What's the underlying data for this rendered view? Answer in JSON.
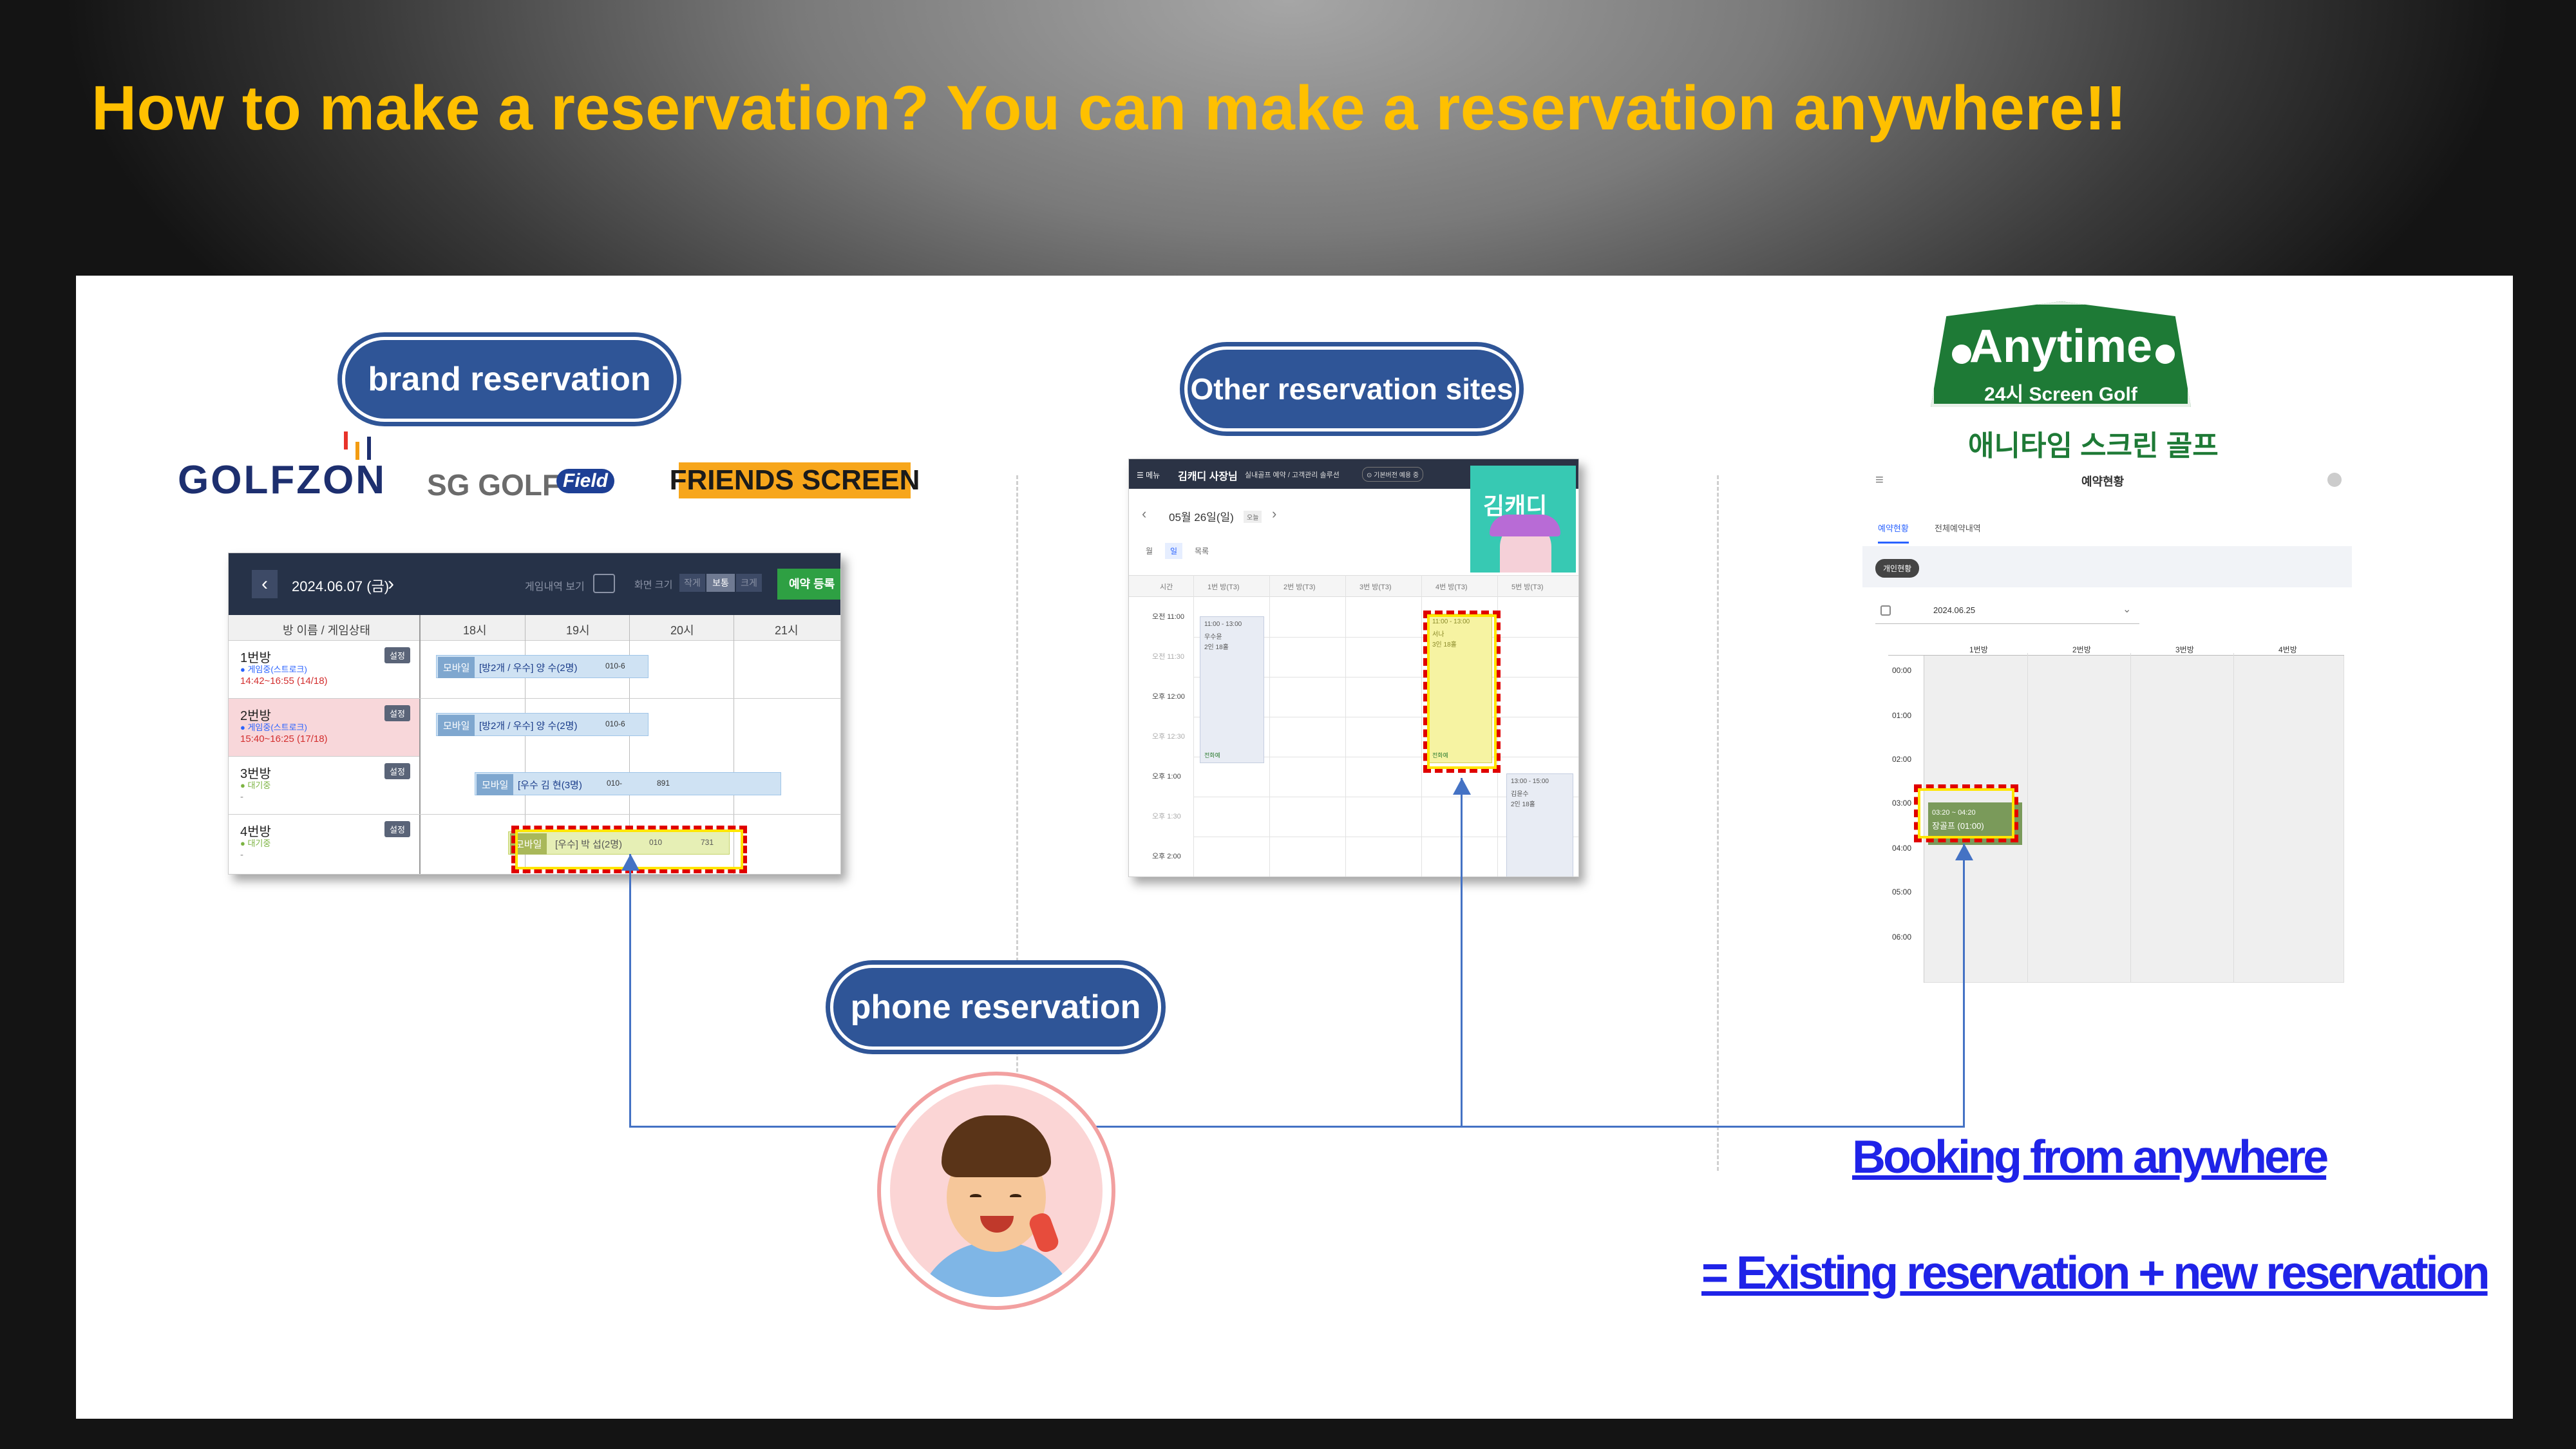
{
  "slide": {
    "title": "How to make a reservation? You can make a reservation anywhere!!"
  },
  "pills": {
    "brand": "brand reservation",
    "other": "Other reservation sites",
    "phone": "phone reservation"
  },
  "brands": {
    "golfzon": "GOLFZON",
    "sggolf": "SG GOLF",
    "sggolf_badge": "Field",
    "friends": "FRIENDS SCREEN"
  },
  "anytime": {
    "logo_main": "Anytime",
    "logo_sub": "24시 Screen Golf",
    "korean_name": "애니타임 스크린 골프"
  },
  "shot1": {
    "date": "2024.06.07 (금)",
    "toggle_label": "게임내역 보기",
    "size_label": "화면 크기",
    "size_options": [
      "작게",
      "보통",
      "크게"
    ],
    "register_button": "예약 등록",
    "col_header": "방 이름 / 게임상태",
    "times": [
      "18시",
      "19시",
      "20시",
      "21시"
    ],
    "rooms": [
      {
        "name": "1번방",
        "status": "● 게임중(스트로크)",
        "time": "14:42~16:55 (14/18)",
        "setting": "설정"
      },
      {
        "name": "2번방",
        "status": "● 게임중(스트로크)",
        "time": "15:40~16:25 (17/18)",
        "setting": "설정"
      },
      {
        "name": "3번방",
        "status": "● 대기중",
        "time": "-",
        "setting": "설정"
      },
      {
        "name": "4번방",
        "status": "● 대기중",
        "time": "-",
        "setting": "설정"
      }
    ],
    "bookings": [
      {
        "tag": "모바일",
        "text": "[방2개 / 우수] 양  수(2명)",
        "phone": "010-6"
      },
      {
        "tag": "모바일",
        "text": "[방2개 / 우수] 양  수(2명)",
        "phone": "010-6"
      },
      {
        "tag": "모바일",
        "text": "[우수  김  현(3명)",
        "phone": "010-",
        "extra": "891"
      },
      {
        "tag": "모바일",
        "text": "[우수] 박  섭(2명)",
        "phone": "010",
        "extra": "731"
      }
    ]
  },
  "shot2": {
    "menu": "☰ 메뉴",
    "user": "김캐디 사장님",
    "nav": "실내골프 예약 / 고객관리 솔루션",
    "nav_btn": "⊙ 기본버전 예용 중",
    "date": "05월 26일(일)",
    "today": "오늘",
    "views": [
      "월",
      "일",
      "목록"
    ],
    "badge": "김캐디",
    "col_header": "시간",
    "rooms": [
      "1번 방(T3)",
      "2번 방(T3)",
      "3번 방(T3)",
      "4번 방(T3)",
      "5번 방(T3)"
    ],
    "times": [
      "오전 11:00",
      "오전 11:30",
      "오후 12:00",
      "오후 12:30",
      "오후 1:00",
      "오후 1:30",
      "오후 2:00"
    ],
    "events": [
      {
        "time": "11:00 - 13:00",
        "name": "우수윤",
        "people": "2인 18홀",
        "note": "전화예"
      },
      {
        "time": "11:00 - 13:00",
        "name": "서나",
        "people": "3인 18홀",
        "note": "전화예"
      },
      {
        "time": "13:00 - 15:00",
        "name": "김윤수",
        "people": "2인 18홀",
        "note": ""
      }
    ]
  },
  "shot3": {
    "page_title": "예약현황",
    "tabs": [
      "예약현황",
      "전체예약내역"
    ],
    "chip": "개인현황",
    "date": "2024.06.25",
    "rooms": [
      "1번방",
      "2번방",
      "3번방",
      "4번방"
    ],
    "times": [
      "00:00",
      "01:00",
      "02:00",
      "03:00",
      "04:00",
      "05:00",
      "06:00"
    ],
    "event": {
      "time": "03:20 ~ 04:20",
      "name": "장골프 (01:00)"
    }
  },
  "notes": {
    "line1": "Booking from anywhere",
    "line2": "= Existing reservation + new reservation"
  },
  "colors": {
    "title": "#ffc000",
    "pill": "#2f5597",
    "connector": "#4472c4",
    "link": "#1f23e8",
    "highlight": "#e00000"
  }
}
